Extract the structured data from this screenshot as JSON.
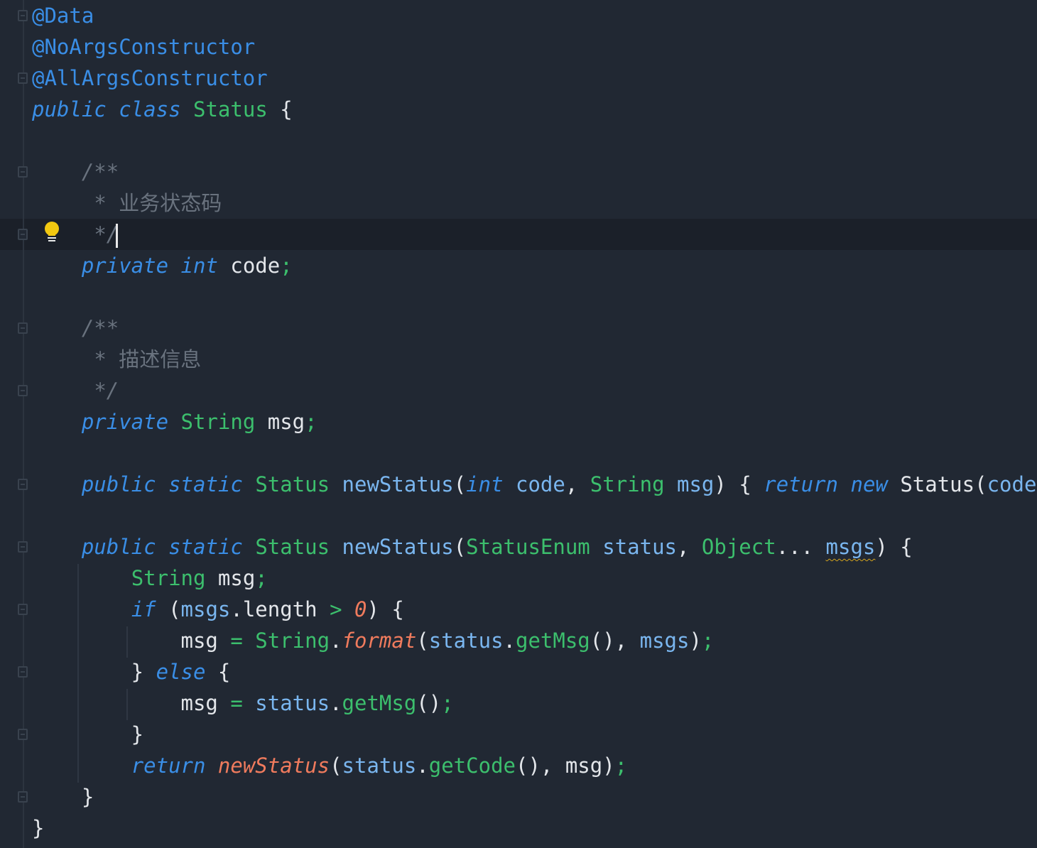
{
  "editor": {
    "current_line": 7,
    "colors": {
      "background": "#212833",
      "keyword": "#3a8ee6",
      "type": "#3cbf6d",
      "parameter": "#7ab6ef",
      "comment": "#69727e",
      "static_method": "#f07b5d",
      "intention_bulb": "#f2c811"
    },
    "gutter_icons": [
      "fold-icon",
      "lightbulb-icon"
    ],
    "lines": [
      [
        [
          "a",
          "@Data"
        ]
      ],
      [
        [
          "a",
          "@NoArgsConstructor"
        ]
      ],
      [
        [
          "a",
          "@AllArgsConstructor"
        ]
      ],
      [
        [
          "k",
          "public"
        ],
        [
          "w",
          " "
        ],
        [
          "k",
          "class"
        ],
        [
          "w",
          " "
        ],
        [
          "t",
          "Status"
        ],
        [
          "w",
          " {"
        ]
      ],
      [],
      [
        [
          "w",
          "    "
        ],
        [
          "c",
          "/**"
        ]
      ],
      [
        [
          "w",
          "     "
        ],
        [
          "c",
          "* "
        ],
        [
          "cz",
          "业务状态码"
        ]
      ],
      [
        [
          "w",
          "     "
        ],
        [
          "c",
          "*/"
        ]
      ],
      [
        [
          "w",
          "    "
        ],
        [
          "k",
          "private"
        ],
        [
          "w",
          " "
        ],
        [
          "k",
          "int"
        ],
        [
          "w",
          " code"
        ],
        [
          "g",
          ";"
        ]
      ],
      [],
      [
        [
          "w",
          "    "
        ],
        [
          "c",
          "/**"
        ]
      ],
      [
        [
          "w",
          "     "
        ],
        [
          "c",
          "* "
        ],
        [
          "cz",
          "描述信息"
        ]
      ],
      [
        [
          "w",
          "     "
        ],
        [
          "c",
          "*/"
        ]
      ],
      [
        [
          "w",
          "    "
        ],
        [
          "k",
          "private"
        ],
        [
          "w",
          " "
        ],
        [
          "t",
          "String"
        ],
        [
          "w",
          " msg"
        ],
        [
          "g",
          ";"
        ]
      ],
      [],
      [
        [
          "w",
          "    "
        ],
        [
          "k",
          "public"
        ],
        [
          "w",
          " "
        ],
        [
          "k",
          "static"
        ],
        [
          "w",
          " "
        ],
        [
          "t",
          "Status"
        ],
        [
          "w",
          " "
        ],
        [
          "p",
          "newStatus"
        ],
        [
          "w",
          "("
        ],
        [
          "k",
          "int"
        ],
        [
          "w",
          " "
        ],
        [
          "p",
          "code"
        ],
        [
          "w",
          ", "
        ],
        [
          "t",
          "String"
        ],
        [
          "w",
          " "
        ],
        [
          "p",
          "msg"
        ],
        [
          "w",
          ") { "
        ],
        [
          "k",
          "return"
        ],
        [
          "w",
          " "
        ],
        [
          "k",
          "new"
        ],
        [
          "w",
          " Status("
        ],
        [
          "p",
          "code"
        ],
        [
          "w",
          ","
        ]
      ],
      [],
      [
        [
          "w",
          "    "
        ],
        [
          "k",
          "public"
        ],
        [
          "w",
          " "
        ],
        [
          "k",
          "static"
        ],
        [
          "w",
          " "
        ],
        [
          "t",
          "Status"
        ],
        [
          "w",
          " "
        ],
        [
          "p",
          "newStatus"
        ],
        [
          "w",
          "("
        ],
        [
          "t",
          "StatusEnum"
        ],
        [
          "w",
          " "
        ],
        [
          "p",
          "status"
        ],
        [
          "w",
          ", "
        ],
        [
          "t",
          "Object"
        ],
        [
          "w",
          "... "
        ],
        [
          "pw",
          "msgs"
        ],
        [
          "w",
          ") {"
        ]
      ],
      [
        [
          "w",
          "        "
        ],
        [
          "t",
          "String"
        ],
        [
          "w",
          " msg"
        ],
        [
          "g",
          ";"
        ]
      ],
      [
        [
          "w",
          "        "
        ],
        [
          "k",
          "if"
        ],
        [
          "w",
          " ("
        ],
        [
          "p",
          "msgs"
        ],
        [
          "w",
          ".length "
        ],
        [
          "g",
          ">"
        ],
        [
          "w",
          " "
        ],
        [
          "f",
          "0"
        ],
        [
          "w",
          ") {"
        ]
      ],
      [
        [
          "w",
          "            msg "
        ],
        [
          "g",
          "="
        ],
        [
          "w",
          " "
        ],
        [
          "t",
          "String"
        ],
        [
          "w",
          "."
        ],
        [
          "f",
          "format"
        ],
        [
          "w",
          "("
        ],
        [
          "p",
          "status"
        ],
        [
          "w",
          "."
        ],
        [
          "g",
          "getMsg"
        ],
        [
          "w",
          "(), "
        ],
        [
          "p",
          "msgs"
        ],
        [
          "w",
          ")"
        ],
        [
          "g",
          ";"
        ]
      ],
      [
        [
          "w",
          "        } "
        ],
        [
          "k",
          "else"
        ],
        [
          "w",
          " {"
        ]
      ],
      [
        [
          "w",
          "            msg "
        ],
        [
          "g",
          "="
        ],
        [
          "w",
          " "
        ],
        [
          "p",
          "status"
        ],
        [
          "w",
          "."
        ],
        [
          "g",
          "getMsg"
        ],
        [
          "w",
          "()"
        ],
        [
          "g",
          ";"
        ]
      ],
      [
        [
          "w",
          "        }"
        ]
      ],
      [
        [
          "w",
          "        "
        ],
        [
          "k",
          "return"
        ],
        [
          "w",
          " "
        ],
        [
          "f",
          "newStatus"
        ],
        [
          "w",
          "("
        ],
        [
          "p",
          "status"
        ],
        [
          "w",
          "."
        ],
        [
          "g",
          "getCode"
        ],
        [
          "w",
          "(), msg)"
        ],
        [
          "g",
          ";"
        ]
      ],
      [
        [
          "w",
          "    }"
        ]
      ],
      [
        [
          "w",
          "}"
        ]
      ]
    ]
  }
}
